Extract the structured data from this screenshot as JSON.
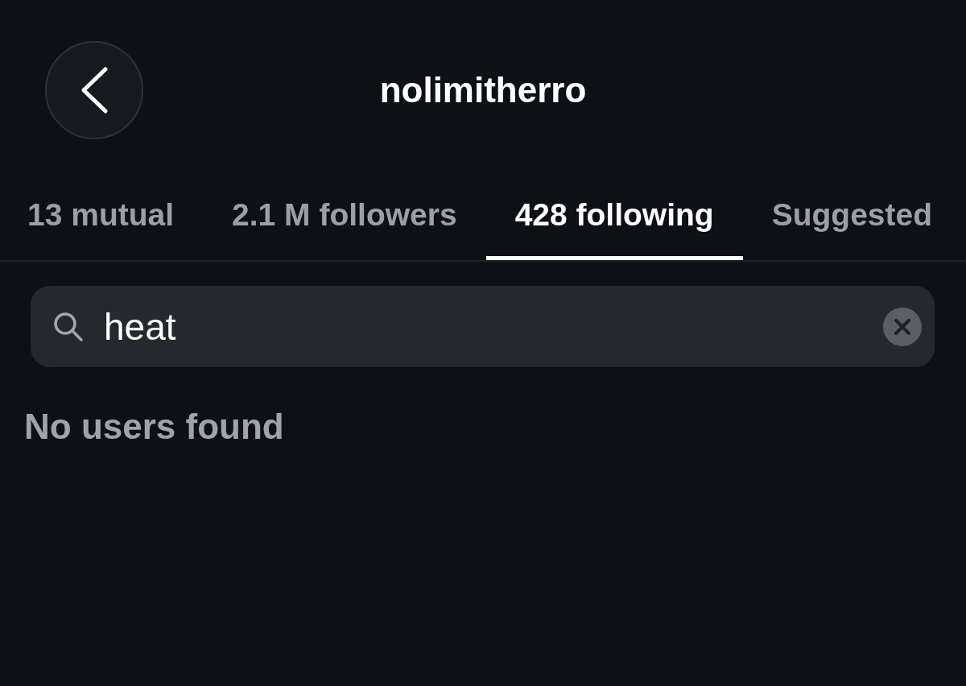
{
  "header": {
    "title": "nolimitherro"
  },
  "tabs": [
    {
      "label": "13 mutual",
      "selected": false
    },
    {
      "label": "2.1 M followers",
      "selected": false
    },
    {
      "label": "428 following",
      "selected": true
    },
    {
      "label": "Suggested",
      "selected": false
    }
  ],
  "search": {
    "value": "heat"
  },
  "results": {
    "message": "No users found"
  }
}
